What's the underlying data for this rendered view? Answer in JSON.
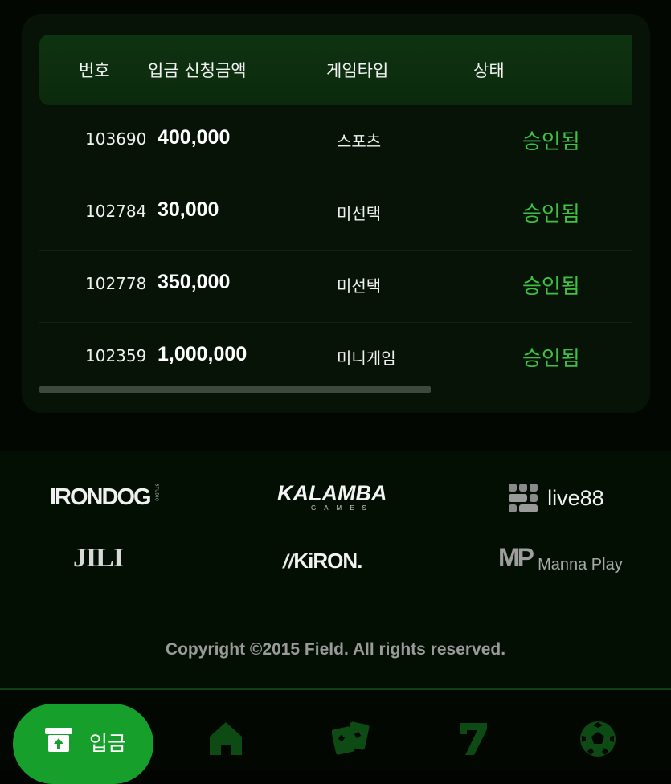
{
  "table": {
    "headers": {
      "number": "번호",
      "amount": "입금 신청금액",
      "game_type": "게임타입",
      "status": "상태"
    },
    "rows": [
      {
        "id": "103690",
        "amount": "400,000",
        "game_type": "스포츠",
        "status": "승인됨"
      },
      {
        "id": "102784",
        "amount": "30,000",
        "game_type": "미선택",
        "status": "승인됨"
      },
      {
        "id": "102778",
        "amount": "350,000",
        "game_type": "미선택",
        "status": "승인됨"
      },
      {
        "id": "102359",
        "amount": "1,000,000",
        "game_type": "미니게임",
        "status": "승인됨"
      }
    ]
  },
  "providers": {
    "irondog": "IRONDOG",
    "irondog_sub": "STUDIO",
    "kalamba": "KALAMBA",
    "kalamba_sub": "GAMES",
    "live88": "live88",
    "jili": "JILI",
    "kiron": "KiRON.",
    "manna_mark": "MP",
    "manna": "Manna Play"
  },
  "footer": {
    "copyright": "Copyright ©2015 Field. All rights reserved."
  },
  "nav": {
    "deposit_label": "입금",
    "items": [
      "deposit-icon",
      "home-icon",
      "cards-icon",
      "slot-seven-icon",
      "soccer-ball-icon"
    ]
  },
  "colors": {
    "status_approved": "#3fc143",
    "accent_button": "#16a02b",
    "header_bg": "#0f3311",
    "inactive_icon": "#0d4a14"
  }
}
